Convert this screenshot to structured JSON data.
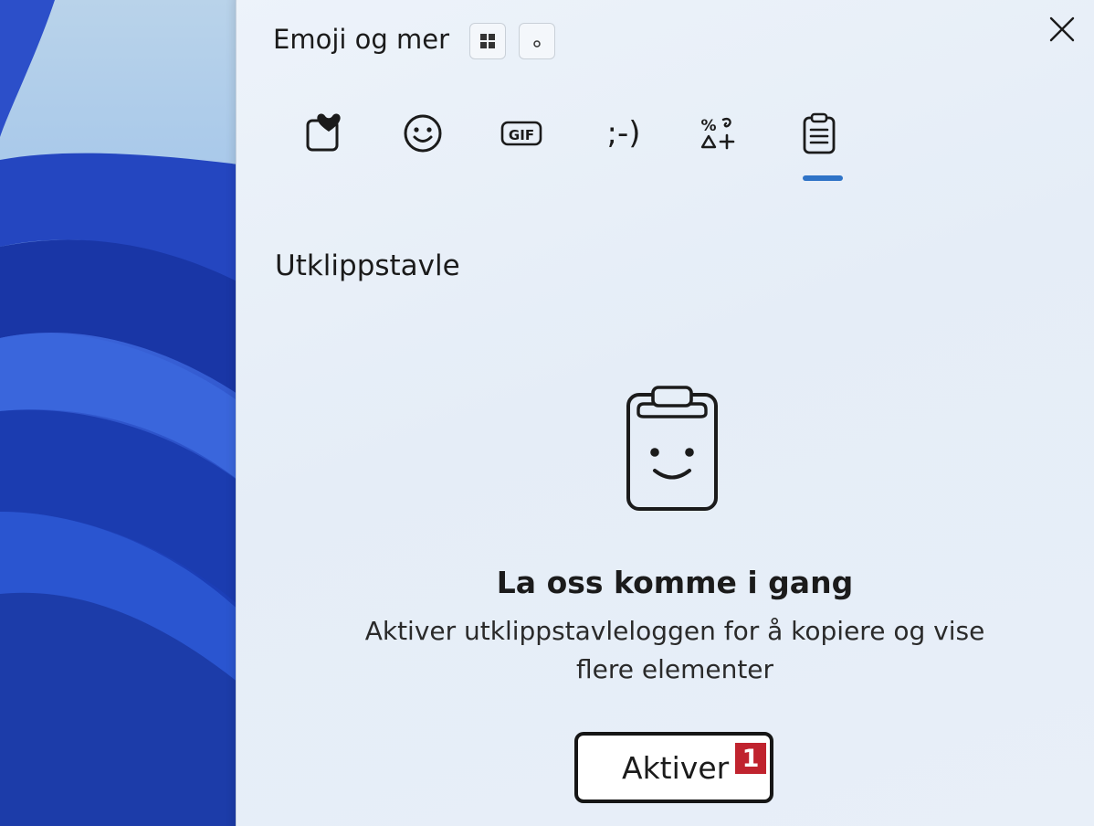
{
  "panel": {
    "title": "Emoji og mer",
    "close_icon": "close-icon",
    "mode_buttons": [
      {
        "icon": "grid-view-icon"
      },
      {
        "icon": "compact-view-icon"
      }
    ]
  },
  "tabs": [
    {
      "icon": "favorites-icon",
      "selected": false
    },
    {
      "icon": "emoji-icon",
      "selected": false
    },
    {
      "icon": "gif-icon",
      "label": "GIF",
      "selected": false
    },
    {
      "icon": "kaomoji-icon",
      "label": ";-)",
      "selected": false
    },
    {
      "icon": "symbols-icon",
      "selected": false
    },
    {
      "icon": "clipboard-icon",
      "selected": true
    }
  ],
  "section": {
    "title": "Utklippstavle"
  },
  "empty_state": {
    "illustration": "smiling-clipboard-icon",
    "title": "La oss komme i gang",
    "description": "Aktiver utklippstavleloggen for å kopiere og vise flere elementer",
    "button_label": "Aktiver",
    "marker": "1"
  },
  "colors": {
    "accent": "#2f73c7",
    "marker": "#c0232e"
  }
}
